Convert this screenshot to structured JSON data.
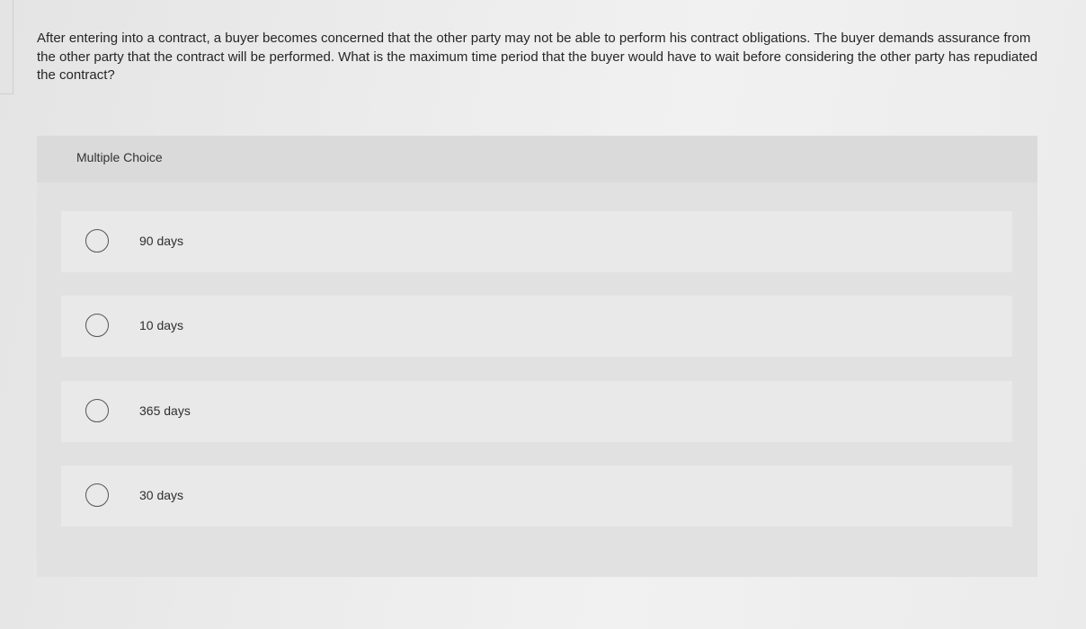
{
  "question": {
    "text": "After entering into a contract, a buyer becomes concerned that the other party may not be able to perform his contract obligations. The buyer demands assurance from the other party that the contract will be performed. What is the maximum time period that the buyer would have to wait before considering the other party has repudiated the contract?"
  },
  "multiple_choice": {
    "label": "Multiple Choice",
    "options": [
      {
        "label": "90 days",
        "selected": false
      },
      {
        "label": "10 days",
        "selected": false
      },
      {
        "label": "365 days",
        "selected": false
      },
      {
        "label": "30 days",
        "selected": false
      }
    ]
  },
  "colors": {
    "panel_background": "#e1e1e1",
    "option_background": "#e9e9e9",
    "radio_border": "#555555",
    "text": "#262626"
  }
}
